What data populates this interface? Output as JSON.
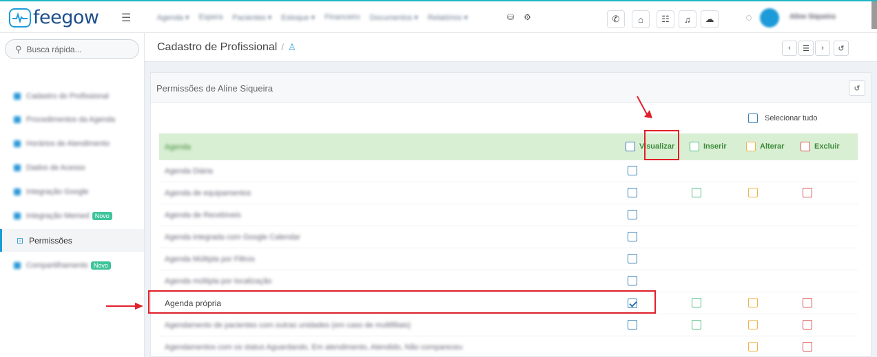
{
  "brand": {
    "name": "feegow",
    "accent": "#1d9bd8"
  },
  "topnav": {
    "items": [
      "Agenda ▾",
      "Espera",
      "Pacientes ▾",
      "Estoque ▾",
      "Financeiro",
      "Documentos ▾",
      "Relatórios ▾"
    ],
    "user_name": "Aline Siqueira"
  },
  "search": {
    "placeholder": "Busca rápida..."
  },
  "sidebar": {
    "items": [
      {
        "label": "Cadastro do Profissional",
        "badge": ""
      },
      {
        "label": "Procedimentos da Agenda",
        "badge": ""
      },
      {
        "label": "Horários de Atendimento",
        "badge": ""
      },
      {
        "label": "Dados de Acesso",
        "badge": ""
      },
      {
        "label": "Integração Google",
        "badge": ""
      },
      {
        "label": "Integração Memed",
        "badge": "Novo"
      },
      {
        "label": "Permissões",
        "badge": ""
      },
      {
        "label": "Compartilhamento",
        "badge": "Novo"
      }
    ]
  },
  "breadcrumb": {
    "title": "Cadastro de Profissional",
    "separator": "/"
  },
  "panel": {
    "title": "Permissões de Aline Siqueira"
  },
  "select_all": {
    "label": "Selecionar tudo"
  },
  "table": {
    "group_label": "Agenda",
    "columns": [
      "Visualizar",
      "Inserir",
      "Alterar",
      "Excluir"
    ],
    "rows": [
      {
        "label": "Agenda Diária",
        "v": false,
        "i": null,
        "a": null,
        "e": null
      },
      {
        "label": "Agenda de equipamentos",
        "v": false,
        "i": false,
        "a": false,
        "e": false
      },
      {
        "label": "Agenda de Recebíveis",
        "v": false,
        "i": null,
        "a": null,
        "e": null
      },
      {
        "label": "Agenda integrada com Google Calendar",
        "v": false,
        "i": null,
        "a": null,
        "e": null
      },
      {
        "label": "Agenda Múltipla por Filtros",
        "v": false,
        "i": null,
        "a": null,
        "e": null
      },
      {
        "label": "Agenda múltipla por localização",
        "v": false,
        "i": null,
        "a": null,
        "e": null
      },
      {
        "label": "Agenda própria",
        "v": true,
        "i": false,
        "a": false,
        "e": false
      },
      {
        "label": "Agendamento de pacientes com outras unidades (em caso de multifiliais)",
        "v": false,
        "i": false,
        "a": false,
        "e": false
      },
      {
        "label": "Agendamentos com os status Aguardando, Em atendimento, Atendido, Não compareceu",
        "v": null,
        "i": null,
        "a": false,
        "e": false
      }
    ]
  }
}
